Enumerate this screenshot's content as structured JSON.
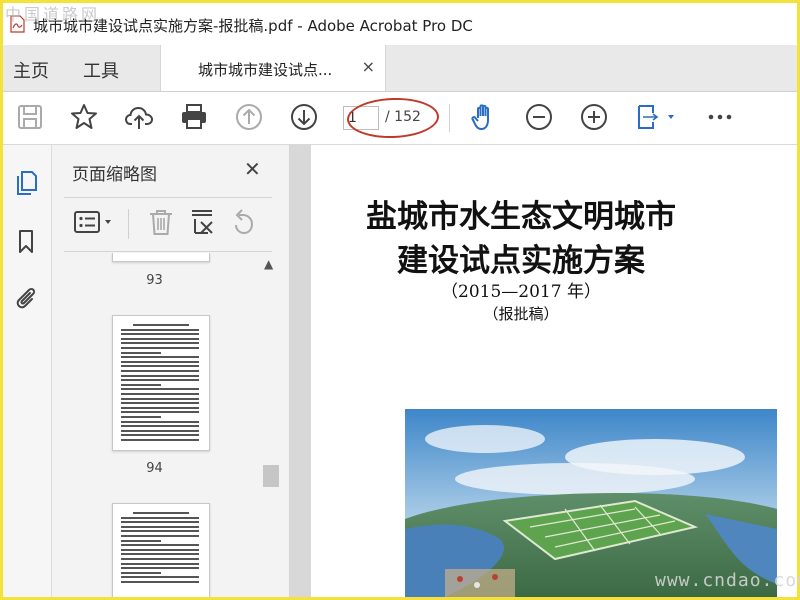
{
  "window": {
    "title": "城市城市建设试点实施方案-报批稿.pdf - Adobe Acrobat Pro DC",
    "watermark_top": "中国道路网"
  },
  "tabs": {
    "home": "主页",
    "tools": "工具",
    "document": "城市城市建设试点...",
    "close": "×"
  },
  "toolbar": {
    "current_page": "1",
    "page_total": "/ 152",
    "icons": [
      "save-icon",
      "star-icon",
      "cloud-upload-icon",
      "print-icon",
      "page-up-icon",
      "page-down-icon",
      "hand-tool-icon",
      "zoom-out-icon",
      "zoom-in-icon",
      "fit-page-icon",
      "more-icon"
    ]
  },
  "panel": {
    "title": "页面缩略图",
    "close": "✕",
    "thumb_labels": [
      "93",
      "94"
    ],
    "scroll_up": "▲",
    "collapse": "◀"
  },
  "document": {
    "title_line1": "盐城市水生态文明城市",
    "title_line2": "建设试点实施方案",
    "subtitle": "（2015—2017 年）",
    "note": "（报批稿）"
  },
  "watermark_bottom": "www.cndao.com",
  "colors": {
    "accent": "#2b6cc4",
    "border_highlight": "#f4e13a",
    "annotation_oval": "#c0392b"
  }
}
